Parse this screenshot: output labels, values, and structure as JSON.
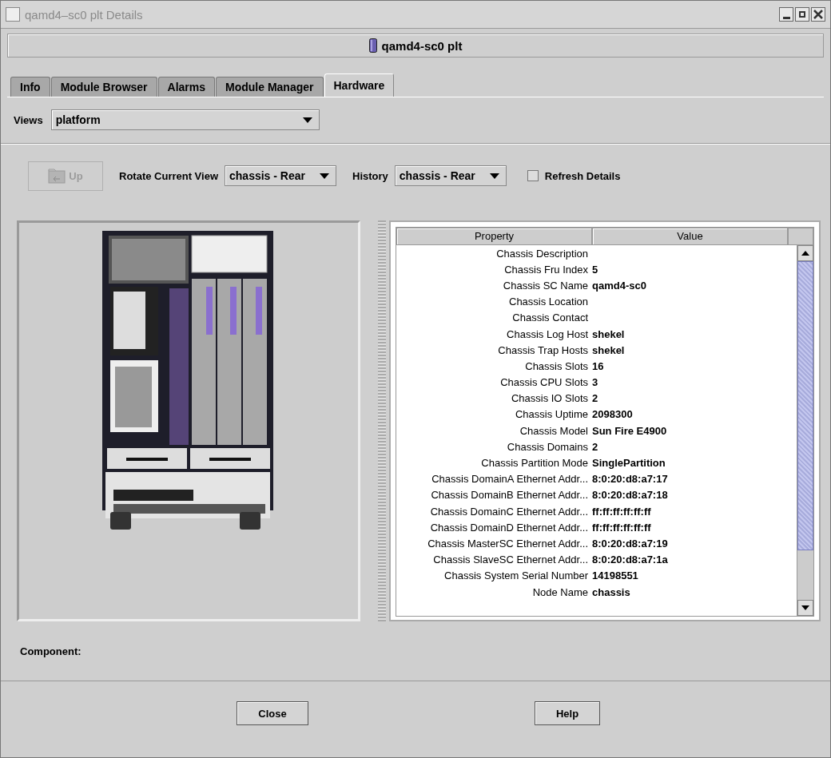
{
  "window": {
    "title": "qamd4–sc0 plt Details"
  },
  "header": {
    "title": "qamd4-sc0 plt"
  },
  "tabs": [
    {
      "label": "Info",
      "selected": false
    },
    {
      "label": "Module Browser",
      "selected": false
    },
    {
      "label": "Alarms",
      "selected": false
    },
    {
      "label": "Module Manager",
      "selected": false
    },
    {
      "label": "Hardware",
      "selected": true
    }
  ],
  "views": {
    "label": "Views",
    "value": "platform"
  },
  "toolbar": {
    "up_button": {
      "label": "Up",
      "disabled": true
    },
    "rotate": {
      "label": "Rotate Current View",
      "value": "chassis - Rear"
    },
    "history": {
      "label": "History",
      "value": "chassis - Rear"
    },
    "refresh": {
      "label": "Refresh Details",
      "checked": false
    }
  },
  "table": {
    "columns": [
      "Property",
      "Value"
    ],
    "rows": [
      {
        "property": "Chassis Description",
        "value": ""
      },
      {
        "property": "Chassis Fru Index",
        "value": "5"
      },
      {
        "property": "Chassis SC Name",
        "value": "qamd4-sc0"
      },
      {
        "property": "Chassis Location",
        "value": ""
      },
      {
        "property": "Chassis Contact",
        "value": ""
      },
      {
        "property": "Chassis Log Host",
        "value": "shekel"
      },
      {
        "property": "Chassis Trap Hosts",
        "value": "shekel"
      },
      {
        "property": "Chassis Slots",
        "value": "16"
      },
      {
        "property": "Chassis CPU Slots",
        "value": "3"
      },
      {
        "property": "Chassis IO Slots",
        "value": "2"
      },
      {
        "property": "Chassis Uptime",
        "value": "2098300"
      },
      {
        "property": "Chassis Model",
        "value": "Sun Fire E4900"
      },
      {
        "property": "Chassis Domains",
        "value": "2"
      },
      {
        "property": "Chassis Partition Mode",
        "value": "SinglePartition"
      },
      {
        "property": "Chassis DomainA Ethernet Addr...",
        "value": "8:0:20:d8:a7:17"
      },
      {
        "property": "Chassis DomainB Ethernet Addr...",
        "value": "8:0:20:d8:a7:18"
      },
      {
        "property": "Chassis DomainC Ethernet Addr...",
        "value": "ff:ff:ff:ff:ff:ff"
      },
      {
        "property": "Chassis DomainD Ethernet Addr...",
        "value": "ff:ff:ff:ff:ff:ff"
      },
      {
        "property": "Chassis MasterSC Ethernet Addr...",
        "value": "8:0:20:d8:a7:19"
      },
      {
        "property": "Chassis SlaveSC Ethernet Addr...",
        "value": "8:0:20:d8:a7:1a"
      },
      {
        "property": "Chassis System Serial Number",
        "value": "14198551"
      },
      {
        "property": "Node Name",
        "value": "chassis"
      }
    ]
  },
  "component": {
    "label": "Component:"
  },
  "buttons": [
    "Close",
    "Help"
  ]
}
